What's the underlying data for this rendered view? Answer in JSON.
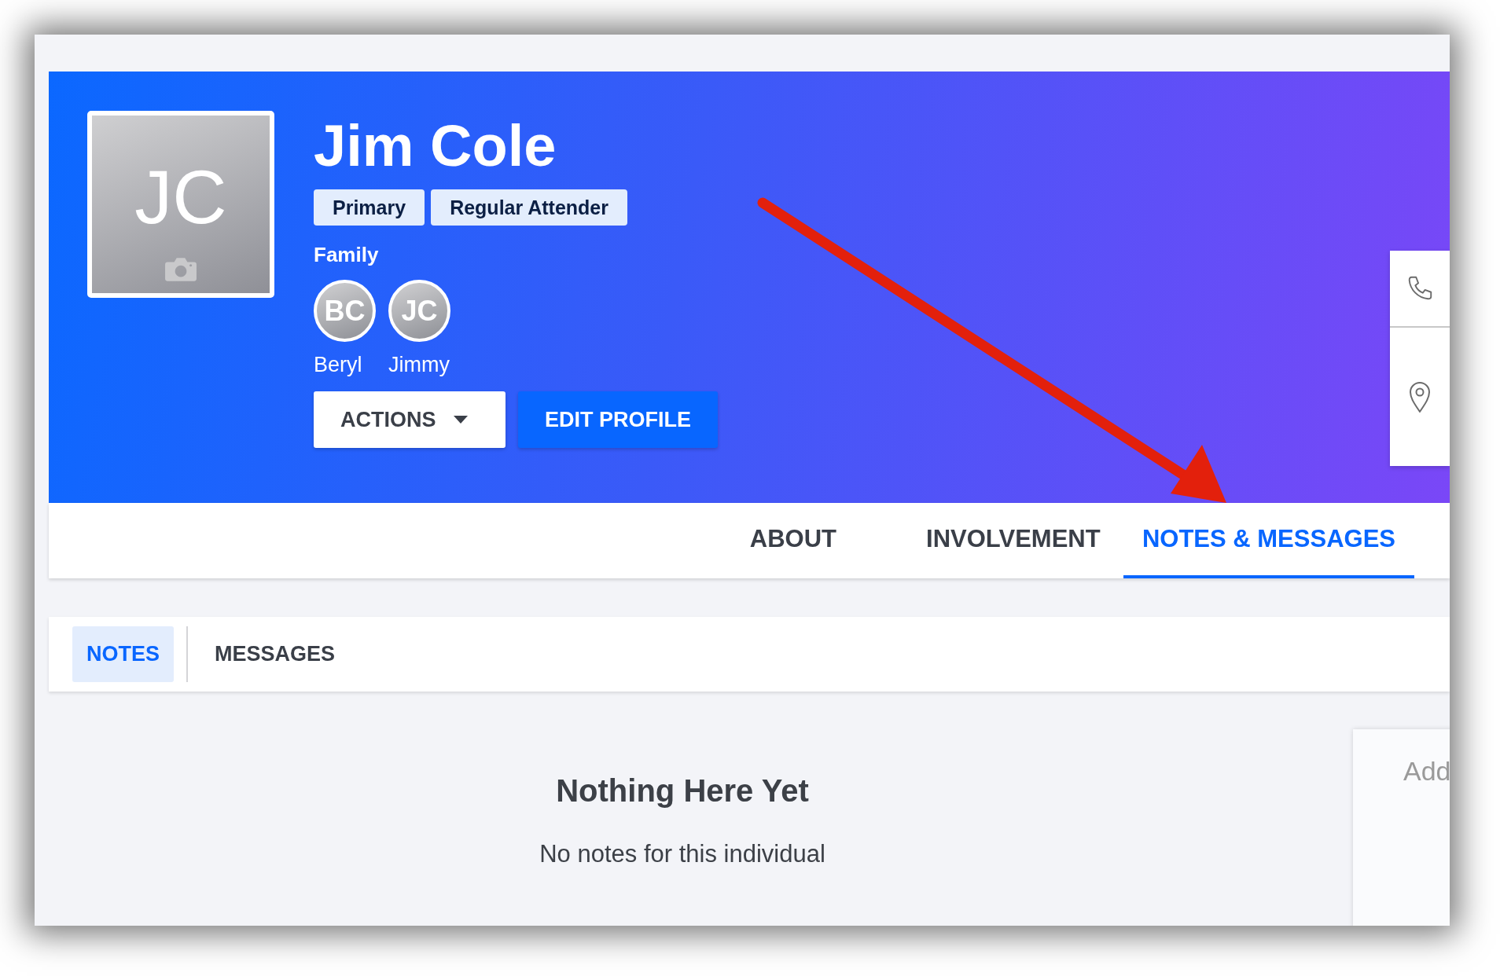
{
  "profile": {
    "initials": "JC",
    "name": "Jim Cole",
    "badges": [
      "Primary",
      "Regular Attender"
    ],
    "family_label": "Family",
    "family": [
      {
        "initials": "BC",
        "name": "Beryl"
      },
      {
        "initials": "JC",
        "name": "Jimmy"
      }
    ],
    "actions_button": "ACTIONS",
    "edit_button": "EDIT PROFILE"
  },
  "tabs": [
    {
      "label": "ABOUT",
      "selected": false
    },
    {
      "label": "INVOLVEMENT",
      "selected": false
    },
    {
      "label": "NOTES & MESSAGES",
      "selected": true
    }
  ],
  "subtabs": [
    {
      "label": "NOTES",
      "selected": true
    },
    {
      "label": "MESSAGES",
      "selected": false
    }
  ],
  "empty_state": {
    "title": "Nothing Here Yet",
    "message": "No notes for this individual"
  },
  "side_card": {
    "heading": "Add"
  }
}
